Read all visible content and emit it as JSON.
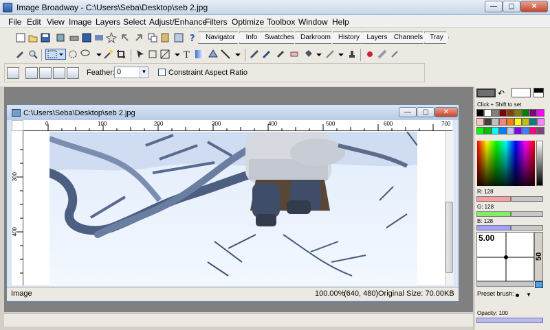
{
  "app": {
    "title": "Image Broadway - C:\\Users\\Seba\\Desktop\\seb 2.jpg"
  },
  "window": {
    "minimize": "—",
    "maximize": "▢",
    "close": "✕"
  },
  "menus": [
    "File",
    "Edit",
    "View",
    "Image",
    "Layers",
    "Select",
    "Adjust/Enhance",
    "Filters",
    "Optimize",
    "Toolbox",
    "Window",
    "Help"
  ],
  "dock_tabs": [
    "Navigator",
    "Info",
    "Swatches",
    "Darkroom",
    "History",
    "Layers",
    "Channels",
    "Tray"
  ],
  "options": {
    "feather_label": "Feather:",
    "feather_value": "0",
    "constraint_label": "Constraint Aspect Ratio"
  },
  "document": {
    "title": "C:\\Users\\Seba\\Desktop\\seb 2.jpg",
    "ruler_top": [
      "0",
      "100",
      "200",
      "300",
      "400",
      "500",
      "600",
      "700"
    ],
    "ruler_left": [
      "300",
      "400"
    ]
  },
  "status": {
    "left": "Image",
    "zoom": "100.00%",
    "coords": "(640, 480)",
    "original_size": "Original Size: 70.00KB"
  },
  "app_status": "",
  "panel": {
    "click_shift": "Click + Shift to set",
    "r_label": "R: 128",
    "g_label": "G: 128",
    "b_label": "B: 128",
    "r_value": 128,
    "g_value": 128,
    "b_value": 128,
    "brush_size": "5.00",
    "brush_side": "50",
    "preset_brush": "Preset brush:",
    "opacity_label": "Opacity: 100"
  },
  "swatches": [
    "#000000",
    "#ffffff",
    "#808080",
    "#800000",
    "#804000",
    "#808000",
    "#008000",
    "#800080",
    "#ff00ff",
    "#ffc0c0",
    "#404040",
    "#c0c0c0",
    "#ff8080",
    "#ff8000",
    "#ffff00",
    "#c0c000",
    "#008080",
    "#ff80ff",
    "#00ff00",
    "#00c000",
    "#00ffff",
    "#0080ff",
    "#c0c0ff",
    "#8000ff",
    "#4080ff",
    "#ff0080",
    "#804080"
  ]
}
